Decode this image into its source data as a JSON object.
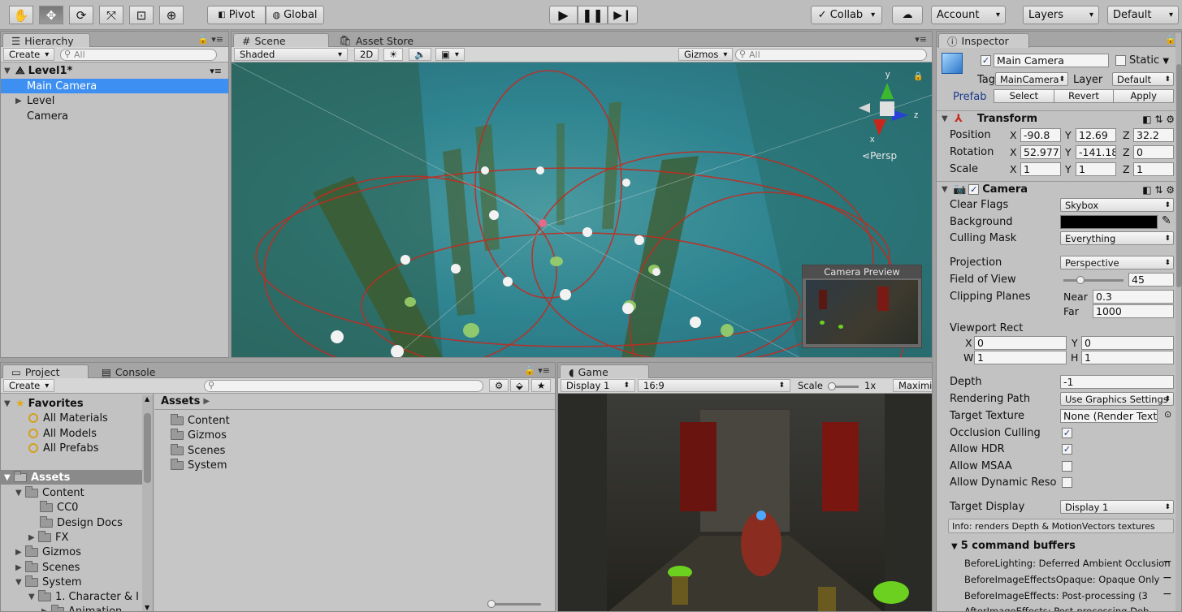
{
  "toolbar": {
    "pivot": "Pivot",
    "global": "Global",
    "collab": "Collab",
    "account": "Account",
    "layers": "Layers",
    "layout": "Default"
  },
  "hierarchy": {
    "tab": "Hierarchy",
    "create": "Create",
    "search_placeholder": "All",
    "scene_name": "Level1*",
    "items": [
      "Main Camera",
      "Level",
      "Camera"
    ]
  },
  "scene": {
    "tab": "Scene",
    "asset_store_tab": "Asset Store",
    "shading": "Shaded",
    "mode_2d": "2D",
    "gizmos": "Gizmos",
    "search_placeholder": "All",
    "persp": "Persp",
    "axis_y": "y",
    "axis_x": "x",
    "axis_z": "z",
    "camera_preview": "Camera Preview"
  },
  "project": {
    "tab": "Project",
    "console_tab": "Console",
    "create": "Create",
    "favorites": "Favorites",
    "favorite_items": [
      "All Materials",
      "All Models",
      "All Prefabs"
    ],
    "assets_root": "Assets",
    "tree": [
      "Content",
      "CC0",
      "Design Docs",
      "FX",
      "Gizmos",
      "Scenes",
      "System",
      "1. Character & I",
      "Animation"
    ],
    "breadcrumb": "Assets",
    "folders": [
      "Content",
      "Gizmos",
      "Scenes",
      "System"
    ]
  },
  "game": {
    "tab": "Game",
    "display": "Display 1",
    "aspect": "16:9",
    "scale_label": "Scale",
    "scale_value": "1x",
    "maximize": "Maximi"
  },
  "inspector": {
    "tab": "Inspector",
    "object_name": "Main Camera",
    "static": "Static",
    "tag_label": "Tag",
    "tag_value": "MainCamera",
    "layer_label": "Layer",
    "layer_value": "Default",
    "prefab_label": "Prefab",
    "prefab_select": "Select",
    "prefab_revert": "Revert",
    "prefab_apply": "Apply",
    "transform": {
      "title": "Transform",
      "position_label": "Position",
      "rotation_label": "Rotation",
      "scale_label": "Scale",
      "axis_x": "X",
      "axis_y": "Y",
      "axis_z": "Z",
      "position": [
        "-90.8",
        "12.69",
        "32.2"
      ],
      "rotation": [
        "52.977",
        "-141.18",
        "0"
      ],
      "scale": [
        "1",
        "1",
        "1"
      ]
    },
    "camera": {
      "title": "Camera",
      "clear_flags_label": "Clear Flags",
      "clear_flags": "Skybox",
      "background_label": "Background",
      "culling_mask_label": "Culling Mask",
      "culling_mask": "Everything",
      "projection_label": "Projection",
      "projection": "Perspective",
      "fov_label": "Field of View",
      "fov": "45",
      "fov_fraction": 0.25,
      "clipping_label": "Clipping Planes",
      "near_label": "Near",
      "near": "0.3",
      "far_label": "Far",
      "far": "1000",
      "viewport_label": "Viewport Rect",
      "vp_x_label": "X",
      "vp_y_label": "Y",
      "vp_w_label": "W",
      "vp_h_label": "H",
      "vp_x": "0",
      "vp_y": "0",
      "vp_w": "1",
      "vp_h": "1",
      "depth_label": "Depth",
      "depth": "-1",
      "rendering_path_label": "Rendering Path",
      "rendering_path": "Use Graphics Settings",
      "target_texture_label": "Target Texture",
      "target_texture": "None (Render Texture)",
      "occlusion_label": "Occlusion Culling",
      "hdr_label": "Allow HDR",
      "msaa_label": "Allow MSAA",
      "dynres_label": "Allow Dynamic Reso",
      "target_display_label": "Target Display",
      "target_display": "Display 1",
      "info": "Info: renders Depth & MotionVectors textures",
      "cmd_buffers_title": "5 command buffers",
      "cmd_buffers": [
        "BeforeLighting: Deferred Ambient Occlusion",
        "BeforeImageEffectsOpaque: Opaque Only",
        "BeforeImageEffects: Post-processing (3",
        "AfterImageEffects: Post-processing Deb"
      ]
    }
  },
  "colors": {
    "selection": "#3d8ff2",
    "scene_bg": "#2b7d89",
    "gizmo_red": "#c8281c",
    "gizmo_green": "#3bb82e",
    "gizmo_blue": "#2740d8"
  }
}
